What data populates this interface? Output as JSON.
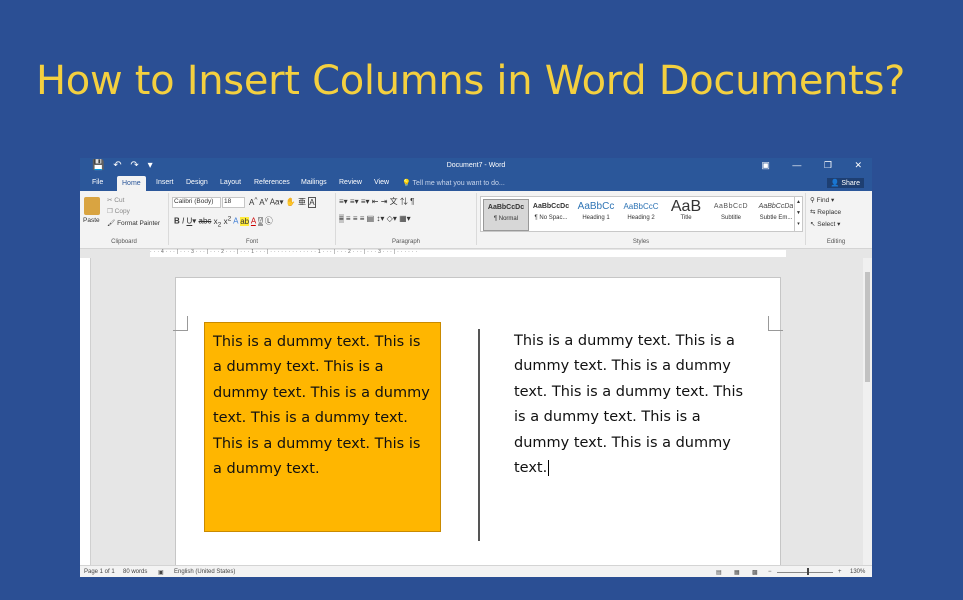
{
  "slide": {
    "title": "How to Insert Columns in Word Documents?"
  },
  "window": {
    "title": "Document7 - Word"
  },
  "tabs": [
    "File",
    "Home",
    "Insert",
    "Design",
    "Layout",
    "References",
    "Mailings",
    "Review",
    "View"
  ],
  "tell_me": "Tell me what you want to do...",
  "share_label": "Share",
  "clipboard": {
    "paste": "Paste",
    "cut": "Cut",
    "copy": "Copy",
    "format_painter": "Format Painter",
    "group": "Clipboard"
  },
  "font": {
    "name": "Calibri (Body)",
    "size": "18",
    "group": "Font"
  },
  "paragraph": {
    "group": "Paragraph"
  },
  "styles": {
    "group": "Styles",
    "items": [
      {
        "sample": "AaBbCcDc",
        "name": "¶ Normal"
      },
      {
        "sample": "AaBbCcDc",
        "name": "¶ No Spac..."
      },
      {
        "sample": "AaBbCc",
        "name": "Heading 1"
      },
      {
        "sample": "AaBbCcC",
        "name": "Heading 2"
      },
      {
        "sample": "AaB",
        "name": "Title"
      },
      {
        "sample": "AaBbCcD",
        "name": "Subtitle"
      },
      {
        "sample": "AaBbCcDa",
        "name": "Subtle Em..."
      }
    ]
  },
  "editing": {
    "find": "Find",
    "replace": "Replace",
    "select": "Select",
    "group": "Editing"
  },
  "document": {
    "left_column_text": "This is a dummy text. This is a dummy text. This is a dummy text. This is a dummy text. This is a dummy text. This is a dummy text. This is a dummy text.",
    "right_column_text": "This is a dummy text. This is a dummy text. This is a dummy text. This is a dummy text. This is a dummy text. This is a dummy text. This is a dummy text.",
    "highlight_color": "#FFB600"
  },
  "status": {
    "page": "Page 1 of 1",
    "words": "80 words",
    "language": "English (United States)",
    "zoom": "130%"
  },
  "colors": {
    "slide_bg": "#2B4F94",
    "title": "#F4D03F",
    "word_blue": "#2B579A"
  }
}
